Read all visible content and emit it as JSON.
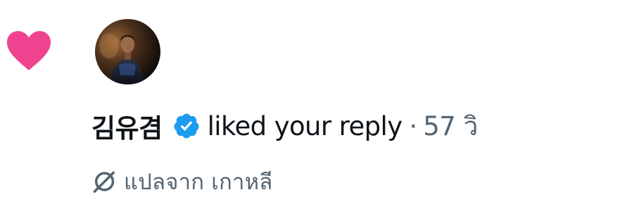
{
  "notification": {
    "type_icon": "heart-icon",
    "avatar_icon": "user-avatar-photo",
    "username": "김유겸",
    "verified_icon": "verified-badge-icon",
    "action": "liked your reply",
    "separator": "·",
    "timestamp": "57 วิ",
    "translate": {
      "icon": "translate-icon",
      "label": "แปลจาก เกาหลี"
    }
  },
  "colors": {
    "heart": "#f0438f",
    "verified": "#1d9bf0",
    "text_primary": "#0f1419",
    "text_secondary": "#536471"
  }
}
